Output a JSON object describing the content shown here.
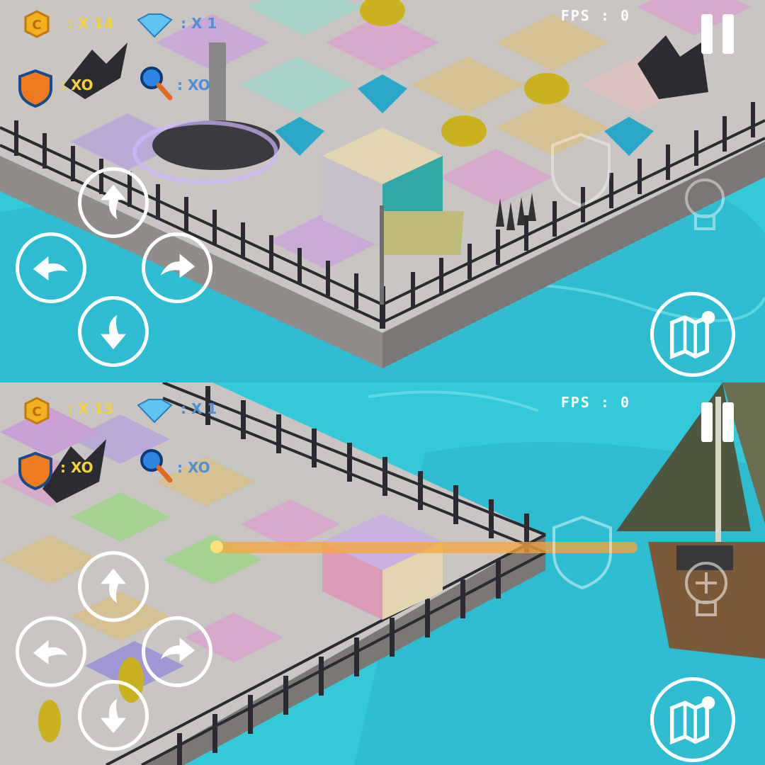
{
  "panels": [
    {
      "id": "top",
      "hud": {
        "coin_count": ": X 14",
        "gem_count": ": X 1",
        "shield_count": ": XO",
        "magnifier_count": ": XO",
        "fps": "FPS : 0",
        "coin_icon_letter": "C"
      }
    },
    {
      "id": "bottom",
      "hud": {
        "coin_count": ": X 13",
        "gem_count": ": X 1",
        "shield_count": ": XO",
        "magnifier_count": ": XO",
        "fps": "FPS : 0",
        "coin_icon_letter": "C"
      }
    }
  ],
  "colors": {
    "water": "#2fc4d6",
    "board": "#c9c6c3",
    "fence": "#2a2a30",
    "coin": "#f2b01e",
    "gem": "#2ba8c7",
    "button": "#ffffff"
  },
  "icons": [
    "coin-icon",
    "diamond-icon",
    "shield-icon",
    "magnifier-icon",
    "pause-icon",
    "map-icon",
    "hint-lightbulb-icon",
    "arrow-up-icon",
    "arrow-left-icon",
    "arrow-right-icon",
    "arrow-down-icon"
  ]
}
